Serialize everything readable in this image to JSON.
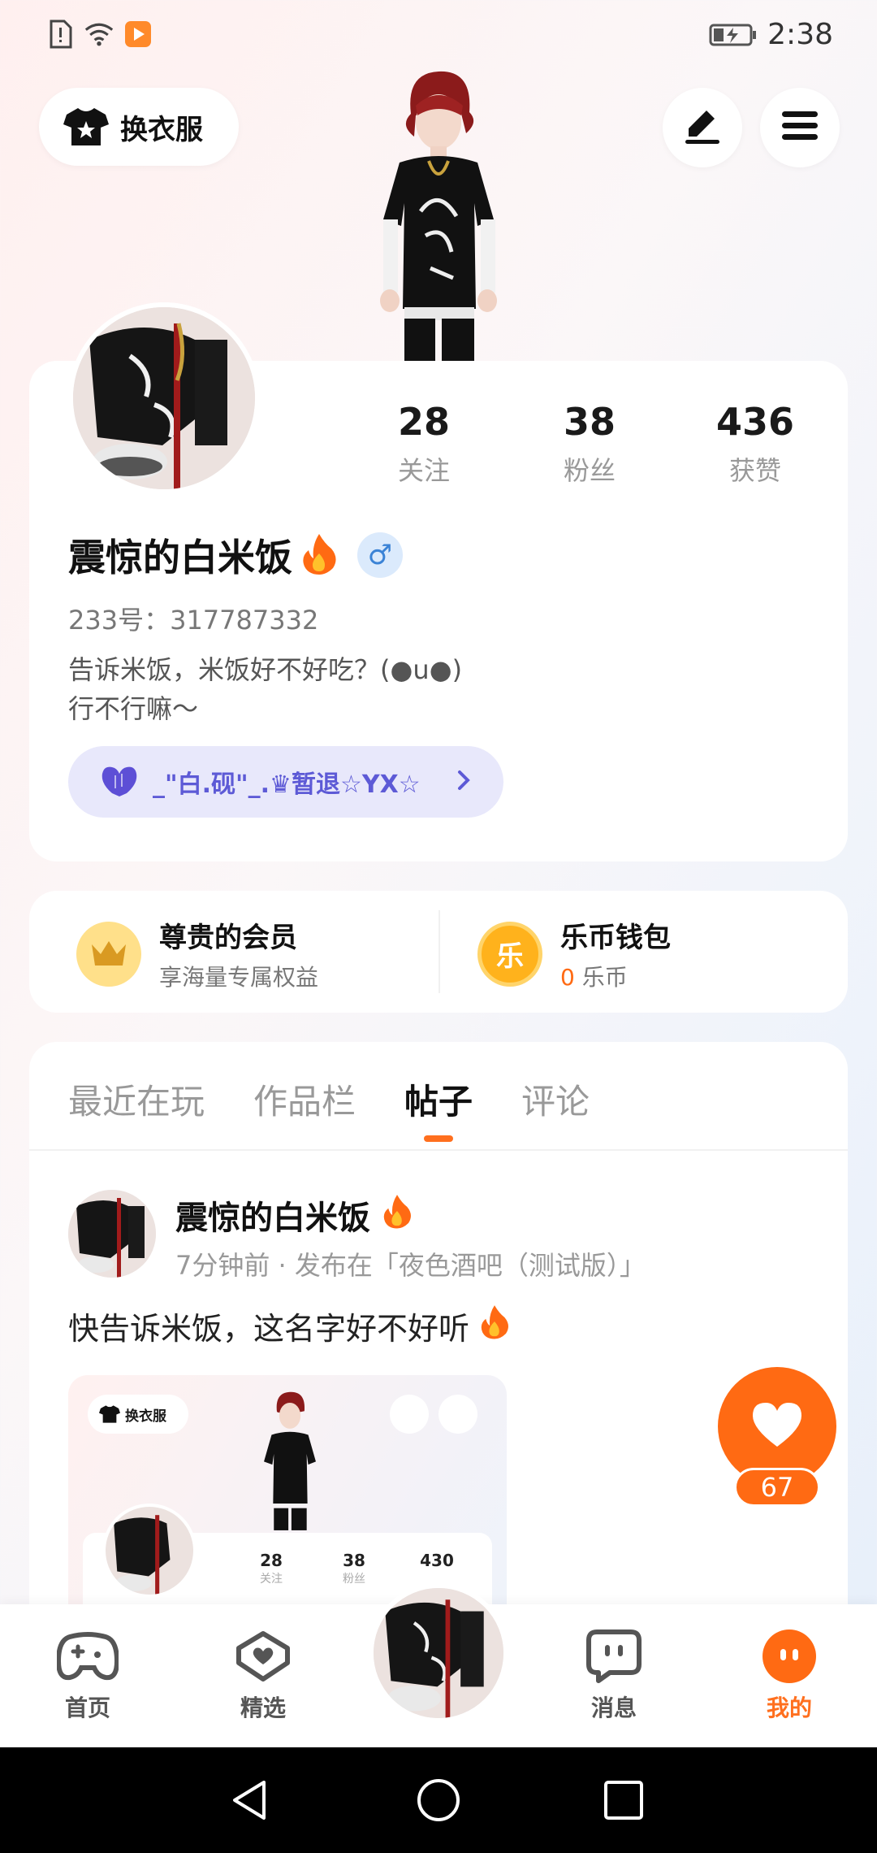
{
  "status": {
    "time": "2:38"
  },
  "header": {
    "outfit_label": "换衣服"
  },
  "profile": {
    "stats": [
      {
        "value": "28",
        "label": "关注"
      },
      {
        "value": "38",
        "label": "粉丝"
      },
      {
        "value": "436",
        "label": "获赞"
      }
    ],
    "username": "震惊的白米饭",
    "gender_symbol": "♂",
    "uid": "233号：317787332",
    "bio_line1": "告诉米饭，米饭好不好吃？(●u●)",
    "bio_line2": "行不行嘛～",
    "guild": "_\"白.砚\"_.♛暂退☆YX☆"
  },
  "wallet": {
    "vip_title": "尊贵的会员",
    "vip_sub": "享海量专属权益",
    "coin_title": "乐币钱包",
    "coin_icon_char": "乐",
    "coin_amount": "0",
    "coin_unit": " 乐币"
  },
  "tabs": [
    {
      "label": "最近在玩",
      "active": false
    },
    {
      "label": "作品栏",
      "active": false
    },
    {
      "label": "帖子",
      "active": true
    },
    {
      "label": "评论",
      "active": false
    }
  ],
  "post": {
    "author": "震惊的白米饭",
    "meta": "7分钟前 · 发布在「夜色酒吧（测试版）」",
    "text": "快告诉米饭，这名字好不好听",
    "thumb": {
      "outfit_label": "换衣服",
      "stats": [
        {
          "value": "28",
          "label": "关注"
        },
        {
          "value": "38",
          "label": "粉丝"
        },
        {
          "value": "430",
          "label": ""
        }
      ]
    }
  },
  "like": {
    "count": "67"
  },
  "nav": [
    {
      "label": "首页",
      "icon": "gamepad-icon"
    },
    {
      "label": "精选",
      "icon": "heart-chat-icon"
    },
    {
      "label": "消息",
      "icon": "message-face-icon"
    },
    {
      "label": "我的",
      "icon": "me-face-icon",
      "active": true
    }
  ],
  "colors": {
    "accent": "#ff6a13",
    "guild_bg": "#e8e8fb",
    "guild_text": "#5d5ad6"
  }
}
